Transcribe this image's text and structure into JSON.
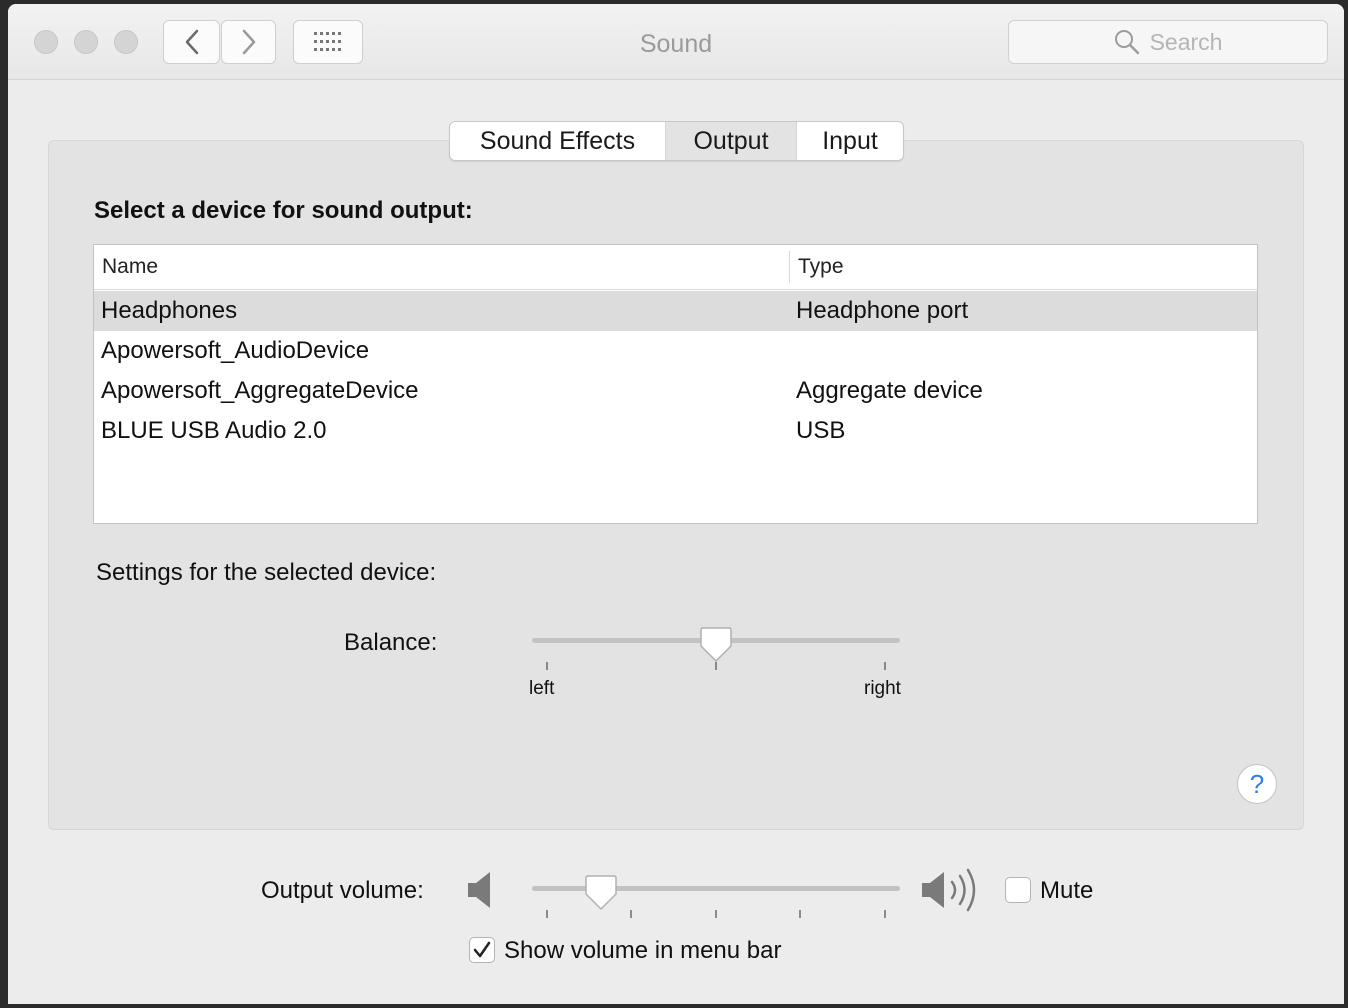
{
  "window": {
    "title": "Sound",
    "search_placeholder": "Search"
  },
  "tabs": [
    {
      "label": "Sound Effects",
      "selected": false
    },
    {
      "label": "Output",
      "selected": true
    },
    {
      "label": "Input",
      "selected": false
    }
  ],
  "output": {
    "heading": "Select a device for sound output:",
    "columns": {
      "name": "Name",
      "type": "Type"
    },
    "devices": [
      {
        "name": "Headphones",
        "type": "Headphone port",
        "selected": true
      },
      {
        "name": "Apowersoft_AudioDevice",
        "type": "",
        "selected": false
      },
      {
        "name": "Apowersoft_AggregateDevice",
        "type": "Aggregate device",
        "selected": false
      },
      {
        "name": "BLUE USB Audio 2.0",
        "type": "USB",
        "selected": false
      }
    ],
    "settings_label": "Settings for the selected device:",
    "balance": {
      "label": "Balance:",
      "left_label": "left",
      "right_label": "right",
      "value": 0.5
    }
  },
  "volume": {
    "label": "Output volume:",
    "value": 0.16,
    "mute_label": "Mute",
    "mute_checked": false
  },
  "menu_bar": {
    "label": "Show volume in menu bar",
    "checked": true
  },
  "help": {
    "symbol": "?"
  },
  "icons": {
    "back": "chevron-left-icon",
    "forward": "chevron-right-icon",
    "grid": "grid-icon",
    "search": "magnifier-icon",
    "volume_low": "speaker-low-icon",
    "volume_high": "speaker-high-icon"
  },
  "colors": {
    "window_bg": "#ececec",
    "panel_bg": "#e3e3e3",
    "selected_row": "#dcdcdc",
    "help_accent": "#2f7ef0"
  }
}
